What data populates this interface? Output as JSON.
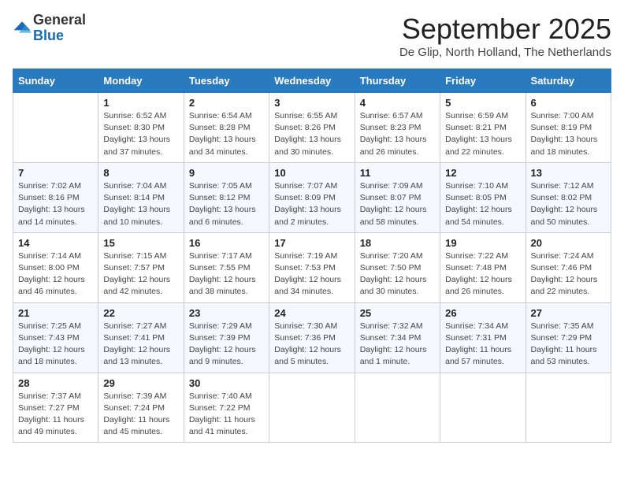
{
  "header": {
    "logo_line1": "General",
    "logo_line2": "Blue",
    "month_title": "September 2025",
    "subtitle": "De Glip, North Holland, The Netherlands"
  },
  "columns": [
    "Sunday",
    "Monday",
    "Tuesday",
    "Wednesday",
    "Thursday",
    "Friday",
    "Saturday"
  ],
  "weeks": [
    [
      {
        "day": "",
        "info": ""
      },
      {
        "day": "1",
        "info": "Sunrise: 6:52 AM\nSunset: 8:30 PM\nDaylight: 13 hours and 37 minutes."
      },
      {
        "day": "2",
        "info": "Sunrise: 6:54 AM\nSunset: 8:28 PM\nDaylight: 13 hours and 34 minutes."
      },
      {
        "day": "3",
        "info": "Sunrise: 6:55 AM\nSunset: 8:26 PM\nDaylight: 13 hours and 30 minutes."
      },
      {
        "day": "4",
        "info": "Sunrise: 6:57 AM\nSunset: 8:23 PM\nDaylight: 13 hours and 26 minutes."
      },
      {
        "day": "5",
        "info": "Sunrise: 6:59 AM\nSunset: 8:21 PM\nDaylight: 13 hours and 22 minutes."
      },
      {
        "day": "6",
        "info": "Sunrise: 7:00 AM\nSunset: 8:19 PM\nDaylight: 13 hours and 18 minutes."
      }
    ],
    [
      {
        "day": "7",
        "info": "Sunrise: 7:02 AM\nSunset: 8:16 PM\nDaylight: 13 hours and 14 minutes."
      },
      {
        "day": "8",
        "info": "Sunrise: 7:04 AM\nSunset: 8:14 PM\nDaylight: 13 hours and 10 minutes."
      },
      {
        "day": "9",
        "info": "Sunrise: 7:05 AM\nSunset: 8:12 PM\nDaylight: 13 hours and 6 minutes."
      },
      {
        "day": "10",
        "info": "Sunrise: 7:07 AM\nSunset: 8:09 PM\nDaylight: 13 hours and 2 minutes."
      },
      {
        "day": "11",
        "info": "Sunrise: 7:09 AM\nSunset: 8:07 PM\nDaylight: 12 hours and 58 minutes."
      },
      {
        "day": "12",
        "info": "Sunrise: 7:10 AM\nSunset: 8:05 PM\nDaylight: 12 hours and 54 minutes."
      },
      {
        "day": "13",
        "info": "Sunrise: 7:12 AM\nSunset: 8:02 PM\nDaylight: 12 hours and 50 minutes."
      }
    ],
    [
      {
        "day": "14",
        "info": "Sunrise: 7:14 AM\nSunset: 8:00 PM\nDaylight: 12 hours and 46 minutes."
      },
      {
        "day": "15",
        "info": "Sunrise: 7:15 AM\nSunset: 7:57 PM\nDaylight: 12 hours and 42 minutes."
      },
      {
        "day": "16",
        "info": "Sunrise: 7:17 AM\nSunset: 7:55 PM\nDaylight: 12 hours and 38 minutes."
      },
      {
        "day": "17",
        "info": "Sunrise: 7:19 AM\nSunset: 7:53 PM\nDaylight: 12 hours and 34 minutes."
      },
      {
        "day": "18",
        "info": "Sunrise: 7:20 AM\nSunset: 7:50 PM\nDaylight: 12 hours and 30 minutes."
      },
      {
        "day": "19",
        "info": "Sunrise: 7:22 AM\nSunset: 7:48 PM\nDaylight: 12 hours and 26 minutes."
      },
      {
        "day": "20",
        "info": "Sunrise: 7:24 AM\nSunset: 7:46 PM\nDaylight: 12 hours and 22 minutes."
      }
    ],
    [
      {
        "day": "21",
        "info": "Sunrise: 7:25 AM\nSunset: 7:43 PM\nDaylight: 12 hours and 18 minutes."
      },
      {
        "day": "22",
        "info": "Sunrise: 7:27 AM\nSunset: 7:41 PM\nDaylight: 12 hours and 13 minutes."
      },
      {
        "day": "23",
        "info": "Sunrise: 7:29 AM\nSunset: 7:39 PM\nDaylight: 12 hours and 9 minutes."
      },
      {
        "day": "24",
        "info": "Sunrise: 7:30 AM\nSunset: 7:36 PM\nDaylight: 12 hours and 5 minutes."
      },
      {
        "day": "25",
        "info": "Sunrise: 7:32 AM\nSunset: 7:34 PM\nDaylight: 12 hours and 1 minute."
      },
      {
        "day": "26",
        "info": "Sunrise: 7:34 AM\nSunset: 7:31 PM\nDaylight: 11 hours and 57 minutes."
      },
      {
        "day": "27",
        "info": "Sunrise: 7:35 AM\nSunset: 7:29 PM\nDaylight: 11 hours and 53 minutes."
      }
    ],
    [
      {
        "day": "28",
        "info": "Sunrise: 7:37 AM\nSunset: 7:27 PM\nDaylight: 11 hours and 49 minutes."
      },
      {
        "day": "29",
        "info": "Sunrise: 7:39 AM\nSunset: 7:24 PM\nDaylight: 11 hours and 45 minutes."
      },
      {
        "day": "30",
        "info": "Sunrise: 7:40 AM\nSunset: 7:22 PM\nDaylight: 11 hours and 41 minutes."
      },
      {
        "day": "",
        "info": ""
      },
      {
        "day": "",
        "info": ""
      },
      {
        "day": "",
        "info": ""
      },
      {
        "day": "",
        "info": ""
      }
    ]
  ]
}
